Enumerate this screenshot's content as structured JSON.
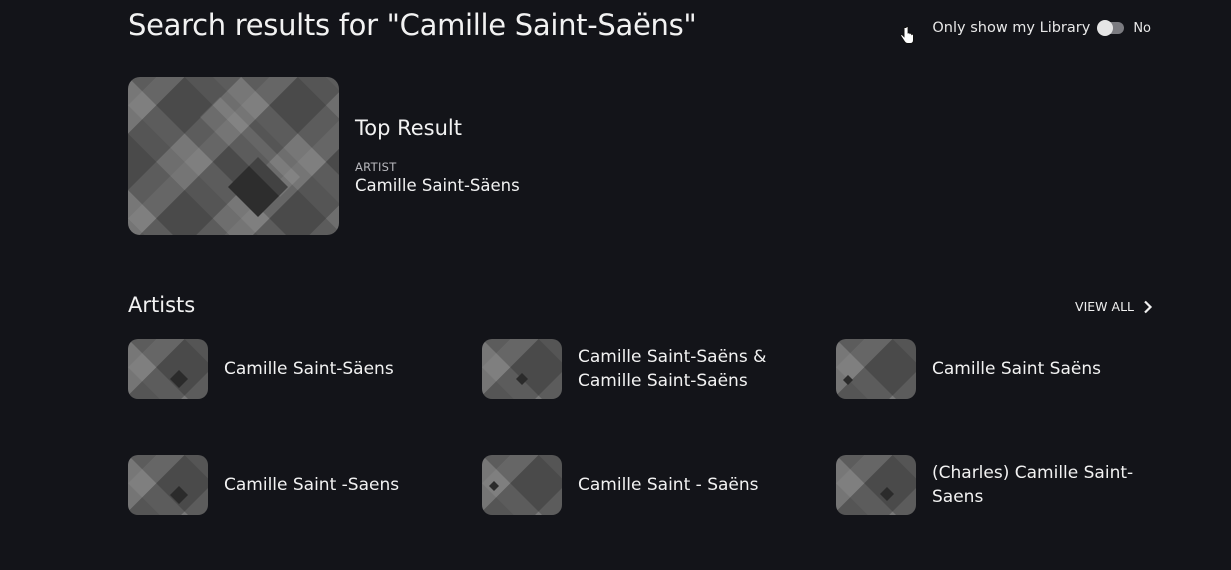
{
  "header": {
    "title": "Search results for \"Camille Saint-Saëns\"",
    "library_toggle": {
      "label": "Only show my Library",
      "state": "No",
      "enabled": false
    }
  },
  "top_result": {
    "heading": "Top Result",
    "type": "ARTIST",
    "name": "Camille Saint-Säens"
  },
  "artists_section": {
    "title": "Artists",
    "view_all_label": "VIEW ALL",
    "items": [
      {
        "name": "Camille Saint-Säens"
      },
      {
        "name": "Camille Saint-Saëns & Camille Saint-Saëns"
      },
      {
        "name": "Camille Saint Saëns"
      },
      {
        "name": "Camille Saint -Saens"
      },
      {
        "name": "Camille Saint - Saëns"
      },
      {
        "name": "(Charles) Camille Saint-Saens"
      }
    ]
  },
  "colors": {
    "background": "#131419",
    "text": "#f2f2f2",
    "placeholder_art": "#5a5a5a"
  },
  "icons": {
    "cursor": "hand-pointer-icon",
    "view_all": "chevron-right-icon"
  }
}
